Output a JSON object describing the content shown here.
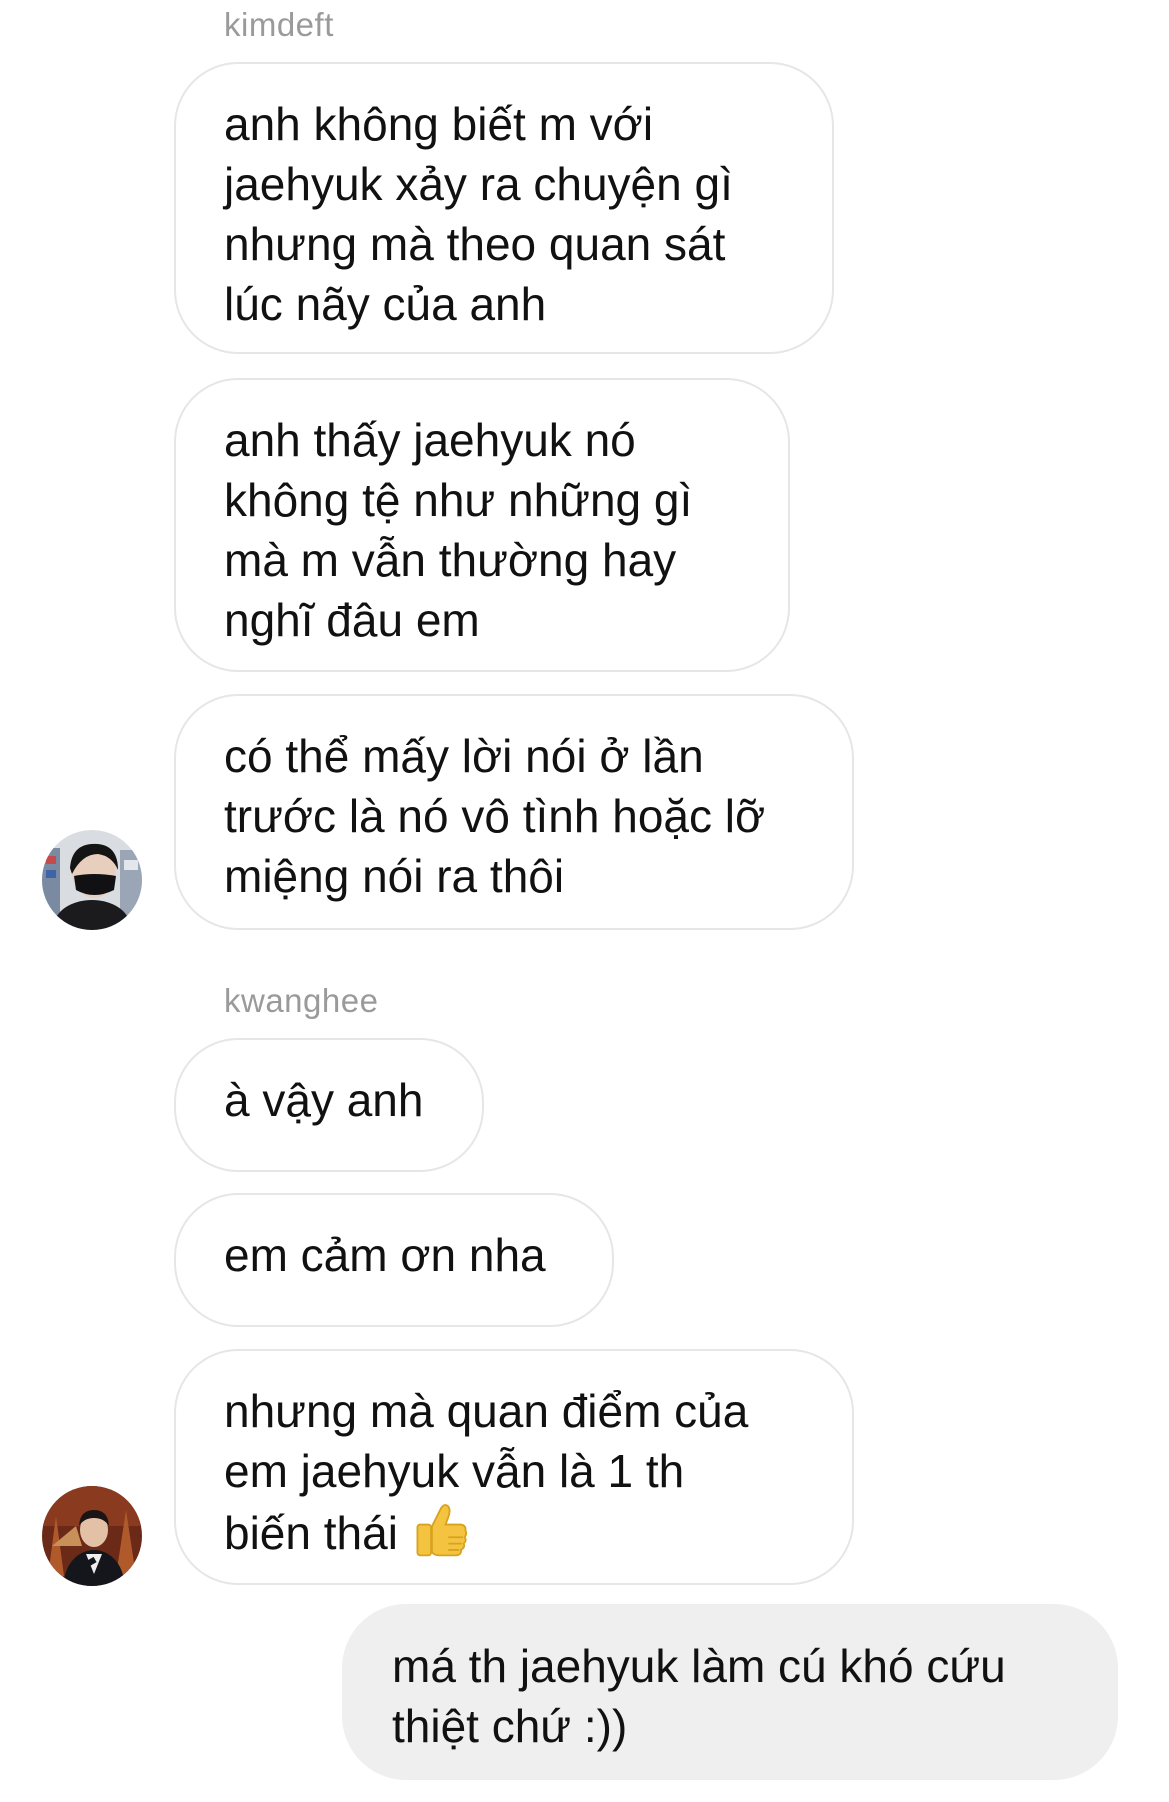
{
  "thread": {
    "groups": [
      {
        "sender": "kimdeft",
        "messages": [
          [
            "anh không biết m với",
            "jaehyuk xảy ra chuyện gì",
            "nhưng mà theo quan sát",
            "lúc nãy của anh"
          ],
          [
            "anh thấy jaehyuk nó",
            "không tệ như những gì",
            "mà m vẫn thường hay",
            "nghĩ đâu em"
          ],
          [
            "có thể mấy lời nói ở lần",
            "trước là nó vô tình hoặc lỡ",
            "miệng nói ra thôi"
          ]
        ],
        "avatar_icon": "profile-photo-masked-person"
      },
      {
        "sender": "kwanghee",
        "messages": [
          [
            "à vậy anh"
          ],
          [
            "em cảm ơn nha"
          ],
          [
            "nhưng mà quan điểm của",
            "em jaehyuk vẫn là 1 th",
            "biến thái"
          ]
        ],
        "emoji": "thumbs-up-icon",
        "avatar_icon": "profile-photo-person-in-suit"
      }
    ],
    "outgoing": [
      "má th jaehyuk làm cú khó cứu",
      "thiệt chứ :))"
    ]
  },
  "colors": {
    "bubble_border": "#e6e6e6",
    "outgoing_bg": "#efefef",
    "sender_name": "#9a9a9a",
    "thumb": "#f4c441"
  }
}
